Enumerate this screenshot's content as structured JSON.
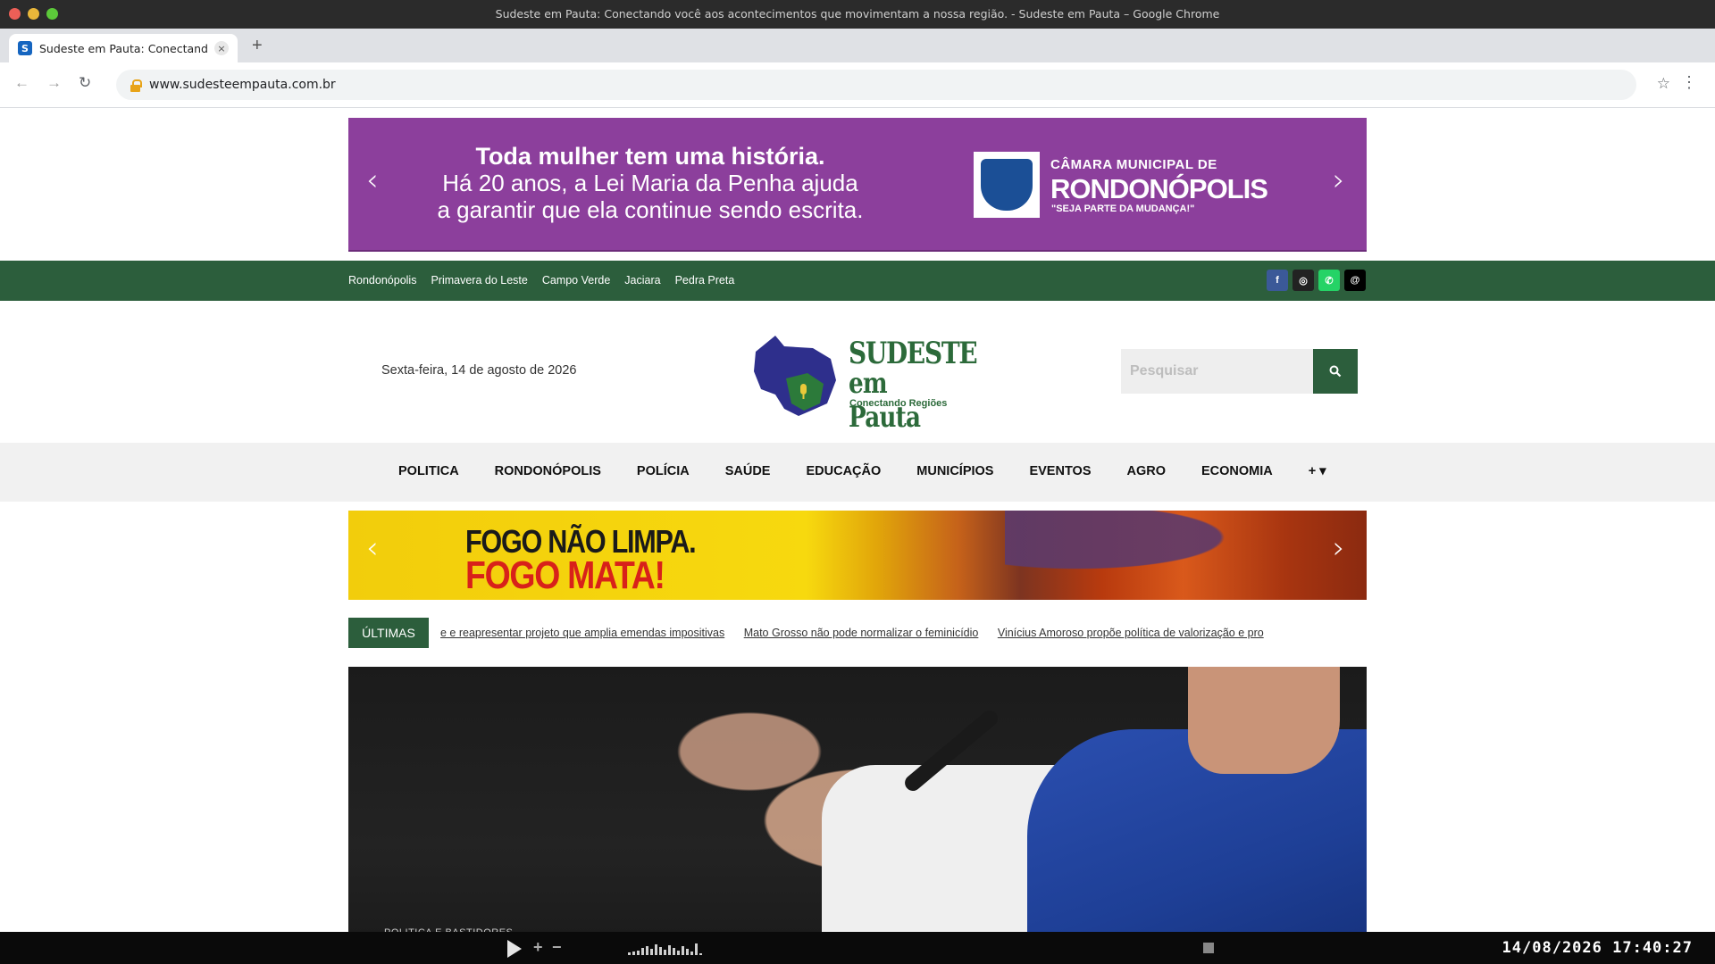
{
  "browser": {
    "window_title": "Sudeste em Pauta: Conectando você aos acontecimentos que movimentam a nossa região. - Sudeste em Pauta – Google Chrome",
    "tab_title": "Sudeste em Pauta: Conectando v...",
    "tab_favicon": "S",
    "tab_close": "×",
    "new_tab": "+",
    "url": "www.sudesteempauta.com.br",
    "back": "←",
    "forward": "→",
    "reload": "↻",
    "bookmark": "☆",
    "menu": "⋮"
  },
  "top_ad": {
    "line1": "Toda mulher tem uma história.",
    "line2": "Há 20 anos, a Lei Maria da Penha ajuda",
    "line3": "a garantir que ela continue sendo escrita.",
    "org_line1": "CÂMARA MUNICIPAL DE",
    "org_line2": "RONDONÓPOLIS",
    "org_slogan": "\"SEJA PARTE DA MUDANÇA!\"",
    "prev": "‹",
    "next": "›",
    "bg_color": "#8c3f9c"
  },
  "topbar": {
    "cities": [
      "Rondonópolis",
      "Primavera do Leste",
      "Campo Verde",
      "Jaciara",
      "Pedra Preta"
    ],
    "socials": [
      {
        "name": "facebook-icon",
        "glyph": "f",
        "color": "#3b5998"
      },
      {
        "name": "instagram-icon",
        "glyph": "◎",
        "color": "#222222"
      },
      {
        "name": "whatsapp-icon",
        "glyph": "✆",
        "color": "#25d366"
      },
      {
        "name": "threads-icon",
        "glyph": "@",
        "color": "#000000"
      }
    ],
    "bg_color": "#2c5e3c"
  },
  "header": {
    "date": "Sexta-feira, 14 de agosto de 2026",
    "logo_line1": "SUDESTE",
    "logo_line2": "em Pauta",
    "logo_tagline": "Conectando Regiões",
    "search_placeholder": "Pesquisar"
  },
  "menu": {
    "items": [
      "POLITICA",
      "RONDONÓPOLIS",
      "POLÍCIA",
      "SAÚDE",
      "EDUCAÇÃO",
      "MUNICÍPIOS",
      "EVENTOS",
      "AGRO",
      "ECONOMIA"
    ],
    "more": "+ ▾"
  },
  "banner2": {
    "line1": "FOGO NÃO LIMPA.",
    "line2": "FOGO MATA!",
    "prev": "‹",
    "next": "›"
  },
  "ticker": {
    "label": "ÚLTIMAS",
    "items": [
      "e e reapresentar projeto que amplia emendas impositivas",
      "Mato Grosso não pode normalizar o feminicídio",
      "Vinícius Amoroso propõe política de valorização e pro"
    ]
  },
  "hero": {
    "category": "POLITICA E BASTIDORES"
  },
  "player": {
    "plus": "+",
    "minus": "−",
    "clock": "14/08/2026 17:40:27"
  }
}
